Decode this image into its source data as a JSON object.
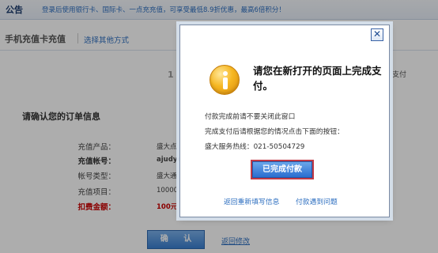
{
  "notice": {
    "title": "公告",
    "text": "登录后使用银行卡、国际卡、一点充充值，可享受最低8.9折优惠，最高6倍积分！"
  },
  "tabs": {
    "active": "手机充值卡充值",
    "other_link": "选择其他方式"
  },
  "steps": {
    "number": "1",
    "right_text": "支付"
  },
  "order": {
    "section_title": "请确认您的订单信息",
    "rows": [
      {
        "label": "充值产品：",
        "value": "盛大点"
      },
      {
        "label": "充值帐号：",
        "value": "ajudyc"
      },
      {
        "label": "帐号类型：",
        "value": "盛大通"
      },
      {
        "label": "充值项目：",
        "value": "10000"
      },
      {
        "label": "扣费金额：",
        "value": "100元"
      }
    ]
  },
  "actions": {
    "confirm": "确 认",
    "back": "返回修改"
  },
  "dialog": {
    "close": "✕",
    "heading": "请您在新打开的页面上完成支付。",
    "line1": "付款完成前请不要关闭此窗口",
    "line2": "完成支付后请根据您的情况点击下面的按钮：",
    "line3": "盛大服务热线：021-50504729",
    "done_button": "已完成付款",
    "link_refill": "返回重新填写信息",
    "link_problem": "付款遇到问题"
  },
  "colors": {
    "link": "#2e6fc0",
    "accent_red": "#c00000",
    "button_blue": "#3a7fd1",
    "overlay": "rgba(0,0,0,0.32)"
  },
  "icons": [
    "info-icon",
    "close-icon"
  ]
}
